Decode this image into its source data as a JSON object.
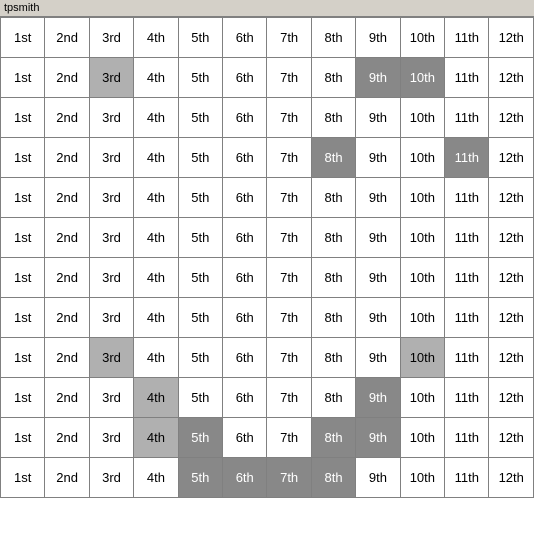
{
  "title": "tpsmith",
  "cols": [
    "1st",
    "2nd",
    "3rd",
    "4th",
    "5th",
    "6th",
    "7th",
    "8th",
    "9th",
    "10th",
    "11th",
    "12th"
  ],
  "rows": [
    {
      "cells": [
        {
          "text": "1st",
          "style": "normal"
        },
        {
          "text": "2nd",
          "style": "normal"
        },
        {
          "text": "3rd",
          "style": "normal"
        },
        {
          "text": "4th",
          "style": "normal"
        },
        {
          "text": "5th",
          "style": "normal"
        },
        {
          "text": "6th",
          "style": "normal"
        },
        {
          "text": "7th",
          "style": "normal"
        },
        {
          "text": "8th",
          "style": "normal"
        },
        {
          "text": "9th",
          "style": "normal"
        },
        {
          "text": "10th",
          "style": "normal"
        },
        {
          "text": "11th",
          "style": "normal"
        },
        {
          "text": "12th",
          "style": "normal"
        }
      ]
    },
    {
      "cells": [
        {
          "text": "1st",
          "style": "normal"
        },
        {
          "text": "2nd",
          "style": "normal"
        },
        {
          "text": "3rd",
          "style": "highlight-light"
        },
        {
          "text": "4th",
          "style": "normal"
        },
        {
          "text": "5th",
          "style": "normal"
        },
        {
          "text": "6th",
          "style": "normal"
        },
        {
          "text": "7th",
          "style": "normal"
        },
        {
          "text": "8th",
          "style": "normal"
        },
        {
          "text": "9th",
          "style": "highlight-dark"
        },
        {
          "text": "10th",
          "style": "highlight-dark"
        },
        {
          "text": "11th",
          "style": "normal"
        },
        {
          "text": "12th",
          "style": "normal"
        }
      ]
    },
    {
      "cells": [
        {
          "text": "1st",
          "style": "normal"
        },
        {
          "text": "2nd",
          "style": "normal"
        },
        {
          "text": "3rd",
          "style": "normal"
        },
        {
          "text": "4th",
          "style": "normal"
        },
        {
          "text": "5th",
          "style": "normal"
        },
        {
          "text": "6th",
          "style": "normal"
        },
        {
          "text": "7th",
          "style": "normal"
        },
        {
          "text": "8th",
          "style": "normal"
        },
        {
          "text": "9th",
          "style": "normal"
        },
        {
          "text": "10th",
          "style": "normal"
        },
        {
          "text": "11th",
          "style": "normal"
        },
        {
          "text": "12th",
          "style": "normal"
        }
      ]
    },
    {
      "cells": [
        {
          "text": "1st",
          "style": "normal"
        },
        {
          "text": "2nd",
          "style": "normal"
        },
        {
          "text": "3rd",
          "style": "normal"
        },
        {
          "text": "4th",
          "style": "normal"
        },
        {
          "text": "5th",
          "style": "normal"
        },
        {
          "text": "6th",
          "style": "normal"
        },
        {
          "text": "7th",
          "style": "normal"
        },
        {
          "text": "8th",
          "style": "highlight-dark"
        },
        {
          "text": "9th",
          "style": "normal"
        },
        {
          "text": "10th",
          "style": "normal"
        },
        {
          "text": "11th",
          "style": "highlight-dark"
        },
        {
          "text": "12th",
          "style": "normal"
        }
      ]
    },
    {
      "cells": [
        {
          "text": "1st",
          "style": "normal"
        },
        {
          "text": "2nd",
          "style": "normal"
        },
        {
          "text": "3rd",
          "style": "normal"
        },
        {
          "text": "4th",
          "style": "normal"
        },
        {
          "text": "5th",
          "style": "normal"
        },
        {
          "text": "6th",
          "style": "normal"
        },
        {
          "text": "7th",
          "style": "normal"
        },
        {
          "text": "8th",
          "style": "normal"
        },
        {
          "text": "9th",
          "style": "normal"
        },
        {
          "text": "10th",
          "style": "normal"
        },
        {
          "text": "11th",
          "style": "normal"
        },
        {
          "text": "12th",
          "style": "normal"
        }
      ]
    },
    {
      "cells": [
        {
          "text": "1st",
          "style": "normal"
        },
        {
          "text": "2nd",
          "style": "normal"
        },
        {
          "text": "3rd",
          "style": "normal"
        },
        {
          "text": "4th",
          "style": "normal"
        },
        {
          "text": "5th",
          "style": "normal"
        },
        {
          "text": "6th",
          "style": "normal"
        },
        {
          "text": "7th",
          "style": "normal"
        },
        {
          "text": "8th",
          "style": "normal"
        },
        {
          "text": "9th",
          "style": "normal"
        },
        {
          "text": "10th",
          "style": "normal"
        },
        {
          "text": "11th",
          "style": "normal"
        },
        {
          "text": "12th",
          "style": "normal"
        }
      ]
    },
    {
      "cells": [
        {
          "text": "1st",
          "style": "normal"
        },
        {
          "text": "2nd",
          "style": "normal"
        },
        {
          "text": "3rd",
          "style": "normal"
        },
        {
          "text": "4th",
          "style": "normal"
        },
        {
          "text": "5th",
          "style": "normal"
        },
        {
          "text": "6th",
          "style": "normal"
        },
        {
          "text": "7th",
          "style": "normal"
        },
        {
          "text": "8th",
          "style": "normal"
        },
        {
          "text": "9th",
          "style": "normal"
        },
        {
          "text": "10th",
          "style": "normal"
        },
        {
          "text": "11th",
          "style": "normal"
        },
        {
          "text": "12th",
          "style": "normal"
        }
      ]
    },
    {
      "cells": [
        {
          "text": "1st",
          "style": "normal"
        },
        {
          "text": "2nd",
          "style": "normal"
        },
        {
          "text": "3rd",
          "style": "normal"
        },
        {
          "text": "4th",
          "style": "normal"
        },
        {
          "text": "5th",
          "style": "normal"
        },
        {
          "text": "6th",
          "style": "normal"
        },
        {
          "text": "7th",
          "style": "normal"
        },
        {
          "text": "8th",
          "style": "normal"
        },
        {
          "text": "9th",
          "style": "normal"
        },
        {
          "text": "10th",
          "style": "normal"
        },
        {
          "text": "11th",
          "style": "normal"
        },
        {
          "text": "12th",
          "style": "normal"
        }
      ]
    },
    {
      "cells": [
        {
          "text": "1st",
          "style": "normal"
        },
        {
          "text": "2nd",
          "style": "normal"
        },
        {
          "text": "3rd",
          "style": "highlight-light"
        },
        {
          "text": "4th",
          "style": "normal"
        },
        {
          "text": "5th",
          "style": "normal"
        },
        {
          "text": "6th",
          "style": "normal"
        },
        {
          "text": "7th",
          "style": "normal"
        },
        {
          "text": "8th",
          "style": "normal"
        },
        {
          "text": "9th",
          "style": "normal"
        },
        {
          "text": "10th",
          "style": "highlight-light"
        },
        {
          "text": "11th",
          "style": "normal"
        },
        {
          "text": "12th",
          "style": "normal"
        }
      ]
    },
    {
      "cells": [
        {
          "text": "1st",
          "style": "normal"
        },
        {
          "text": "2nd",
          "style": "normal"
        },
        {
          "text": "3rd",
          "style": "normal"
        },
        {
          "text": "4th",
          "style": "highlight-light"
        },
        {
          "text": "5th",
          "style": "normal"
        },
        {
          "text": "6th",
          "style": "normal"
        },
        {
          "text": "7th",
          "style": "normal"
        },
        {
          "text": "8th",
          "style": "normal"
        },
        {
          "text": "9th",
          "style": "highlight-dark"
        },
        {
          "text": "10th",
          "style": "normal"
        },
        {
          "text": "11th",
          "style": "normal"
        },
        {
          "text": "12th",
          "style": "normal"
        }
      ]
    },
    {
      "cells": [
        {
          "text": "1st",
          "style": "normal"
        },
        {
          "text": "2nd",
          "style": "normal"
        },
        {
          "text": "3rd",
          "style": "normal"
        },
        {
          "text": "4th",
          "style": "highlight-light"
        },
        {
          "text": "5th",
          "style": "highlight-dark"
        },
        {
          "text": "6th",
          "style": "normal"
        },
        {
          "text": "7th",
          "style": "normal"
        },
        {
          "text": "8th",
          "style": "highlight-dark"
        },
        {
          "text": "9th",
          "style": "highlight-dark"
        },
        {
          "text": "10th",
          "style": "normal"
        },
        {
          "text": "11th",
          "style": "normal"
        },
        {
          "text": "12th",
          "style": "normal"
        }
      ]
    },
    {
      "cells": [
        {
          "text": "1st",
          "style": "normal"
        },
        {
          "text": "2nd",
          "style": "normal"
        },
        {
          "text": "3rd",
          "style": "normal"
        },
        {
          "text": "4th",
          "style": "normal"
        },
        {
          "text": "5th",
          "style": "highlight-dark"
        },
        {
          "text": "6th",
          "style": "highlight-dark"
        },
        {
          "text": "7th",
          "style": "highlight-dark"
        },
        {
          "text": "8th",
          "style": "highlight-dark"
        },
        {
          "text": "9th",
          "style": "normal"
        },
        {
          "text": "10th",
          "style": "normal"
        },
        {
          "text": "11th",
          "style": "normal"
        },
        {
          "text": "12th",
          "style": "normal"
        }
      ]
    }
  ]
}
